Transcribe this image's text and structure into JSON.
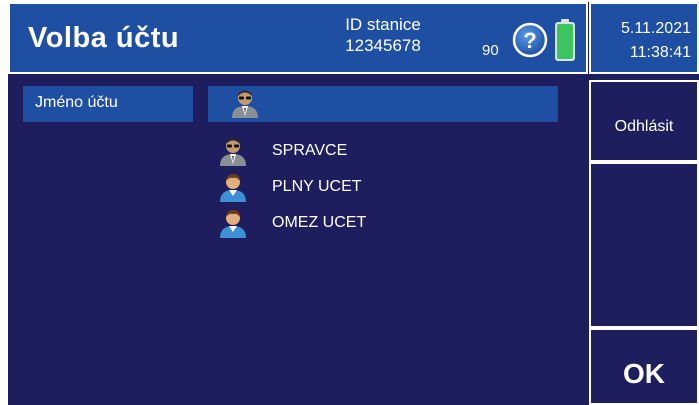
{
  "header": {
    "title": "Volba účtu",
    "station_label": "ID stanice",
    "station_id": "12345678",
    "battery_level": "90",
    "help_icon": "question-circle-icon",
    "battery_icon": "battery-icon"
  },
  "datetime": {
    "date": "5.11.2021",
    "time": "11:38:41"
  },
  "account": {
    "label": "Jméno účtu",
    "selected_icon": "user-secret-icon",
    "users": [
      {
        "name": "SPRAVCE",
        "icon": "admin-user-icon"
      },
      {
        "name": "PLNY UCET",
        "icon": "user-icon"
      },
      {
        "name": "OMEZ UCET",
        "icon": "user-icon"
      }
    ]
  },
  "side": {
    "logout_label": "Odhlásit",
    "ok_label": "OK"
  },
  "colors": {
    "background": "#1e1e5e",
    "panel": "#1f4fa3",
    "battery": "#3cc460"
  }
}
